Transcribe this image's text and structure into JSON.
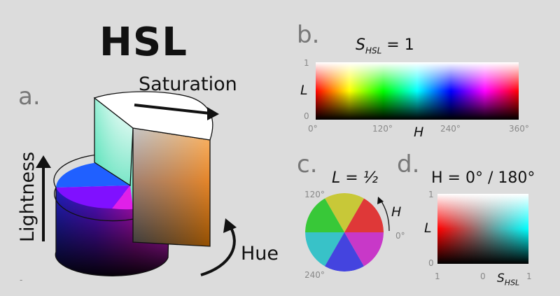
{
  "title": "HSL",
  "panels": {
    "a": {
      "label": "a.",
      "saturation_label": "Saturation",
      "lightness_label": "Lightness",
      "hue_label": "Hue"
    },
    "b": {
      "label": "b.",
      "heading_symbol": "S",
      "heading_subscript": "HSL",
      "heading_value": " = 1",
      "y_label": "L",
      "x_label": "H",
      "y_ticks": [
        "1",
        "0"
      ],
      "x_ticks": [
        "0°",
        "120°",
        "240°",
        "360°"
      ]
    },
    "c": {
      "label": "c.",
      "heading": "L = ½",
      "hue_label": "H",
      "angle_ticks": [
        "120°",
        "0°",
        "240°"
      ]
    },
    "d": {
      "label": "d.",
      "heading": "H = 0° / 180°",
      "y_label": "L",
      "x_label_symbol": "S",
      "x_label_subscript": "HSL",
      "y_ticks": [
        "1",
        "0"
      ],
      "x_ticks": [
        "1",
        "0",
        "1"
      ]
    }
  },
  "footnote": "-",
  "colors": {
    "background": "#dcdcdc",
    "text": "#111111",
    "label_gray": "#777777"
  }
}
